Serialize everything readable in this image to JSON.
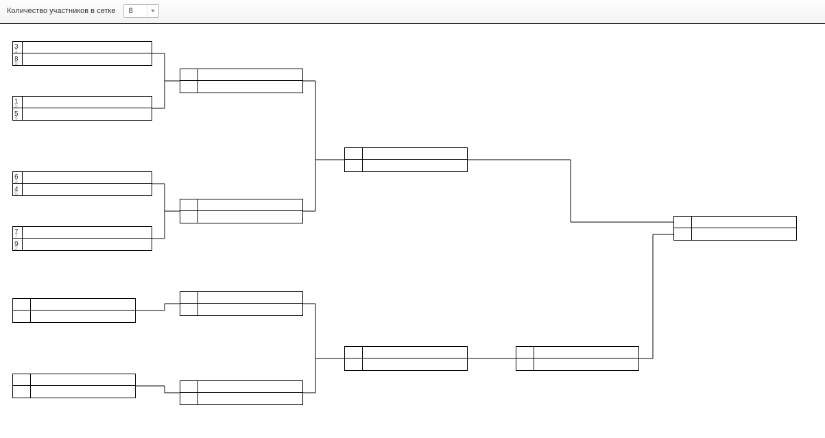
{
  "topbar": {
    "label": "Количество участников в сетке",
    "select_value": "8"
  },
  "round1": [
    {
      "p1_seed": "3",
      "p1_sub": "1",
      "p2_seed": "8",
      "p2_sub": "8"
    },
    {
      "p1_seed": "1",
      "p1_sub": "5",
      "p2_seed": "5",
      "p2_sub": "4"
    },
    {
      "p1_seed": "6",
      "p1_sub": "3",
      "p2_seed": "4",
      "p2_sub": "6"
    },
    {
      "p1_seed": "7",
      "p1_sub": "7",
      "p2_seed": "9",
      "p2_sub": "2"
    }
  ]
}
